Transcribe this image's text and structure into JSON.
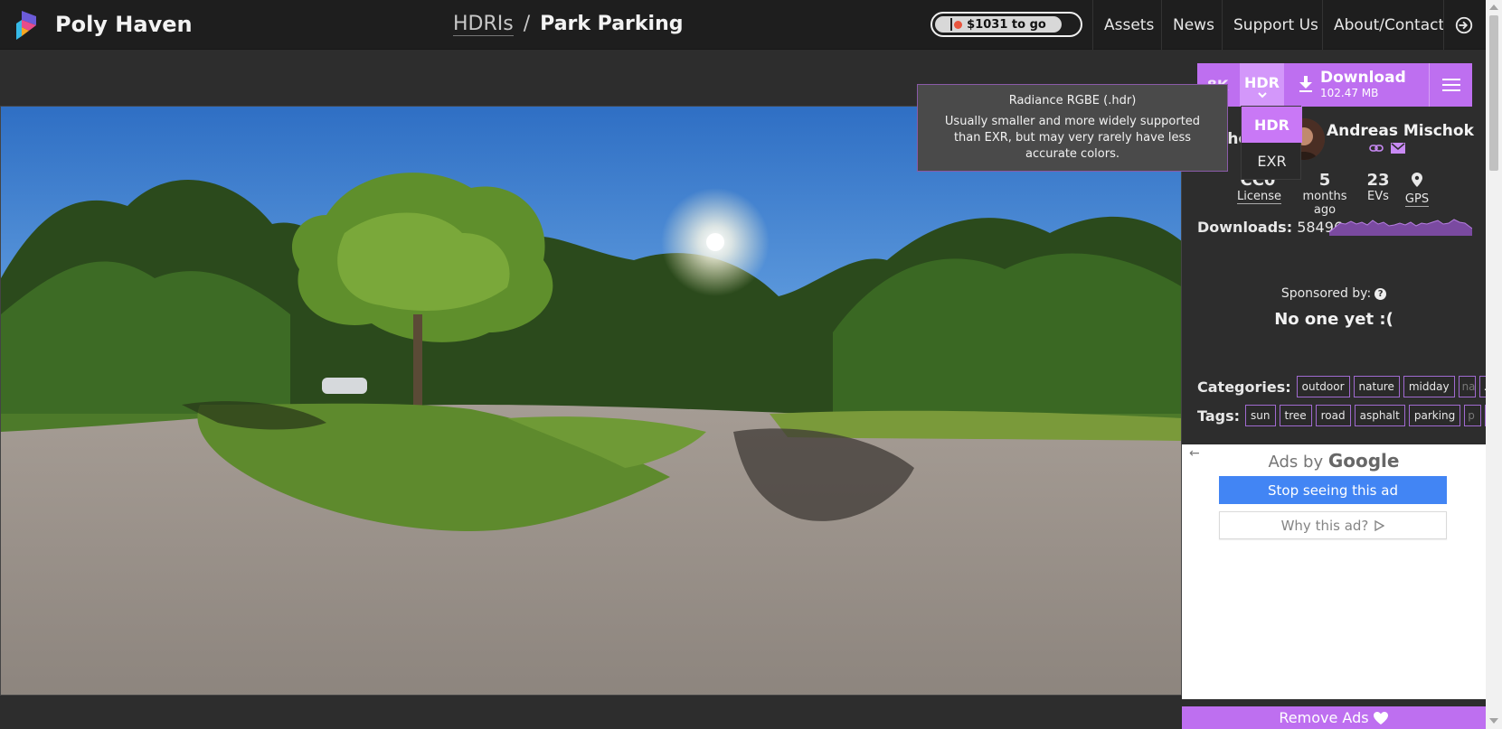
{
  "site": {
    "name": "Poly Haven"
  },
  "breadcrumb": {
    "parent": "HDRIs",
    "separator": "/",
    "current": "Park Parking"
  },
  "funding": {
    "label": "$1031 to go"
  },
  "nav": {
    "assets": "Assets",
    "news": "News",
    "support": "Support Us",
    "about": "About/Contact"
  },
  "download": {
    "resolution": "8K",
    "format": "HDR",
    "label": "Download",
    "size": "102.47 MB",
    "format_options": [
      "HDR",
      "EXR"
    ]
  },
  "tooltip": {
    "title": "Radiance RGBE (.hdr)",
    "body": "Usually smaller and more widely supported than EXR, but may very rarely have less accurate colors."
  },
  "author": {
    "label": "Author:",
    "name": "Andreas Mischok"
  },
  "stats": {
    "license_value": "CC0",
    "license_label": "License",
    "age_value": "5",
    "age_label": "months ago",
    "evs_value": "23",
    "evs_label": "EVs",
    "gps_label": "GPS"
  },
  "downloads": {
    "label": "Downloads:",
    "count": "58496"
  },
  "sponsor": {
    "label": "Sponsored by:",
    "value": "No one yet :("
  },
  "categories": {
    "label": "Categories:",
    "items": [
      "outdoor",
      "nature",
      "midday",
      "na"
    ],
    "more": "..."
  },
  "tags": {
    "label": "Tags:",
    "items": [
      "sun",
      "tree",
      "road",
      "asphalt",
      "parking",
      "p"
    ],
    "more": "..."
  },
  "ad": {
    "title_prefix": "Ads by",
    "title_brand": "Google",
    "stop": "Stop seeing this ad",
    "why": "Why this ad?"
  },
  "remove_ads": {
    "label": "Remove Ads"
  },
  "colors": {
    "accent": "#be6ff0",
    "accent_light": "#d397fa",
    "topbar": "#1e1e1e",
    "page_bg": "#2d2d2d",
    "ad_button": "#4285f4"
  },
  "icons": [
    "poly-haven-logo",
    "download-icon",
    "hamburger-icon",
    "link-icon",
    "mail-icon",
    "gps-pin-icon",
    "help-icon",
    "login-icon",
    "back-arrow-icon",
    "heart-icon",
    "adchoices-icon"
  ]
}
